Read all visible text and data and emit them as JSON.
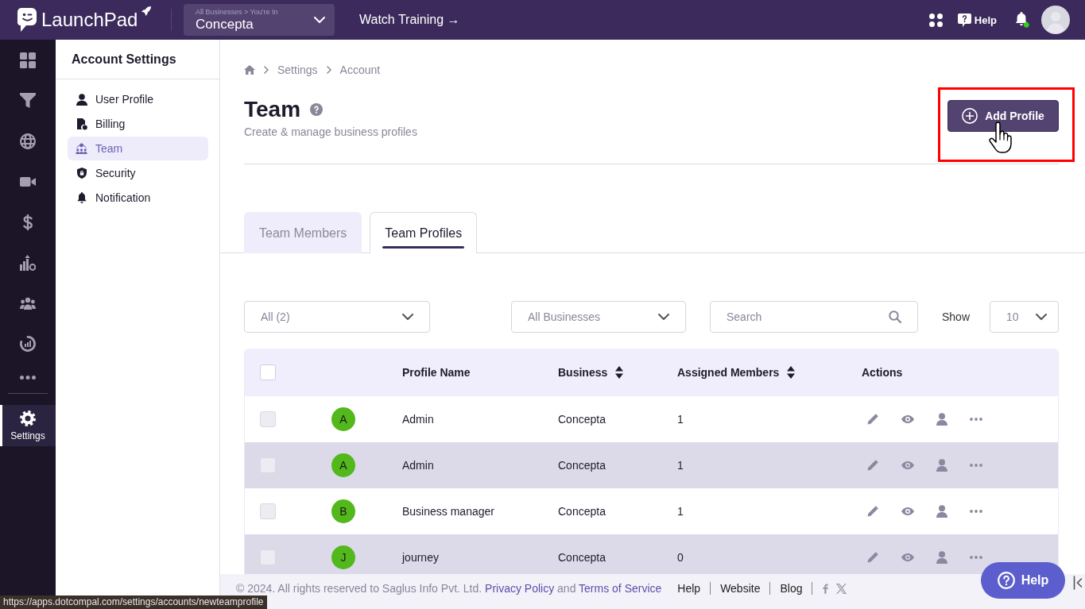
{
  "top_bar": {
    "logo_text": "LaunchPad",
    "business_selector": {
      "caption": "All Businesses > You're In",
      "value": "Concepta"
    },
    "watch_training": "Watch Training →",
    "help": "Help"
  },
  "rail": {
    "items": [
      {
        "selected": false
      },
      {
        "selected": false
      },
      {
        "selected": false
      },
      {
        "selected": false
      },
      {
        "selected": false
      },
      {
        "selected": false
      },
      {
        "selected": false
      },
      {
        "selected": false
      }
    ],
    "settings": {
      "label": "Settings",
      "selected": true
    }
  },
  "account_menu": {
    "title": "Account Settings",
    "items": [
      {
        "label": "User Profile",
        "selected": false
      },
      {
        "label": "Billing",
        "selected": false
      },
      {
        "label": "Team",
        "selected": true
      },
      {
        "label": "Security",
        "selected": false
      },
      {
        "label": "Notification",
        "selected": false
      }
    ]
  },
  "breadcrumb": [
    "Settings",
    "Account"
  ],
  "page": {
    "title": "Team",
    "subtitle": "Create & manage business profiles",
    "add_button": {
      "label": "Add Profile",
      "highlighted": true
    }
  },
  "tabs": [
    {
      "label": "Team Members",
      "selected": false
    },
    {
      "label": "Team Profiles",
      "selected": true
    }
  ],
  "filters": {
    "status": {
      "value": "All (2)"
    },
    "business": {
      "value": "All Businesses"
    },
    "search": {
      "placeholder": "Search"
    },
    "show_label": "Show",
    "page_size": {
      "value": "10"
    }
  },
  "table": {
    "select_all": {
      "checked": false
    },
    "columns": [
      {
        "label": "Profile Name",
        "sortable": false
      },
      {
        "label": "Business",
        "sortable": true
      },
      {
        "label": "Assigned Members",
        "sortable": true
      },
      {
        "label": "Actions",
        "sortable": false
      }
    ],
    "rows": [
      {
        "initial": "A",
        "name": "Admin",
        "business": "Concepta",
        "members": "1",
        "checked": false
      },
      {
        "initial": "A",
        "name": "Admin",
        "business": "Concepta",
        "members": "1",
        "checked": false
      },
      {
        "initial": "B",
        "name": "Business manager",
        "business": "Concepta",
        "members": "1",
        "checked": false
      },
      {
        "initial": "J",
        "name": "journey",
        "business": "Concepta",
        "members": "0",
        "checked": false
      }
    ]
  },
  "footer": {
    "copyright": "© 2024. All rights reserved to Saglus Info Pvt. Ltd.",
    "privacy_link": "Privacy Policy",
    "conjunction": "and",
    "terms_link": "Terms of Service",
    "nav_links": [
      "Help",
      "Website",
      "Blog"
    ]
  },
  "help_fab": {
    "label": "Help"
  },
  "status_url": "https://apps.dotcompal.com/settings/accounts/newteamprofile"
}
